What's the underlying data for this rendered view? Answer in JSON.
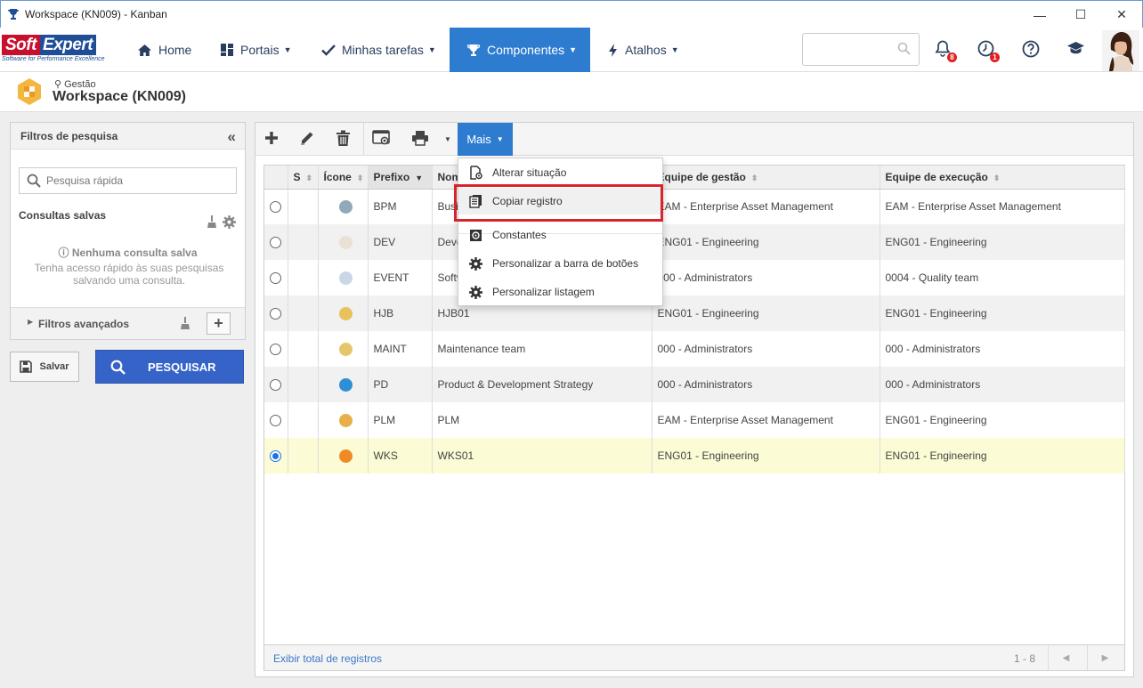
{
  "window": {
    "title": "Workspace (KN009) - Kanban",
    "controls": [
      "—",
      "☐",
      "✕"
    ]
  },
  "navbar": {
    "logo_soft": "Soft",
    "logo_expert": "Expert",
    "logo_tagline": "Software for Performance Excellence",
    "items": [
      {
        "label": "Home"
      },
      {
        "label": "Portais"
      },
      {
        "label": "Minhas tarefas"
      },
      {
        "label": "Componentes"
      },
      {
        "label": "Atalhos"
      }
    ],
    "notifications_badge": "8",
    "tasks_badge": "1",
    "accent": "#2e7cd0"
  },
  "header": {
    "breadcrumb": "Gestão",
    "title": "Workspace (KN009)"
  },
  "filters": {
    "title": "Filtros de pesquisa",
    "collapse": "«",
    "quick_search_placeholder": "Pesquisa rápida",
    "saved_title": "Consultas salvas",
    "no_saved": "Nenhuma consulta salva",
    "no_saved_desc": "Tenha acesso rápido às suas pesquisas salvando uma consulta.",
    "advanced": "Filtros avançados",
    "save_label": "Salvar",
    "search_label": "PESQUISAR"
  },
  "toolbar": {
    "more_label": "Mais"
  },
  "menu": {
    "items": [
      {
        "label": "Alterar situação",
        "icon": "change-status-icon"
      },
      {
        "label": "Copiar registro",
        "icon": "copy-icon"
      },
      {
        "label": "Constantes",
        "icon": "constants-icon"
      },
      {
        "label": "Personalizar a barra de botões",
        "icon": "gear-icon"
      },
      {
        "label": "Personalizar listagem",
        "icon": "gear-icon"
      }
    ]
  },
  "grid": {
    "columns": [
      "",
      "S",
      "Ícone",
      "Prefixo",
      "Nome",
      "Equipe de gestão",
      "Equipe de execução"
    ],
    "rows": [
      {
        "prefix": "BPM",
        "name": "Business Process Management",
        "mgmt": "EAM - Enterprise Asset Management",
        "exec": "EAM - Enterprise Asset Management",
        "icon_color": "#8fa9b8",
        "selected": false
      },
      {
        "prefix": "DEV",
        "name": "Development",
        "mgmt": "ENG01 - Engineering",
        "exec": "ENG01 - Engineering",
        "icon_color": "#e9e1d3",
        "selected": false
      },
      {
        "prefix": "EVENT",
        "name": "Software Event",
        "mgmt": "000 - Administrators",
        "exec": "0004 - Quality team",
        "icon_color": "#c9d7e8",
        "selected": false
      },
      {
        "prefix": "HJB",
        "name": "HJB01",
        "mgmt": "ENG01 - Engineering",
        "exec": "ENG01 - Engineering",
        "icon_color": "#e8c25a",
        "selected": false
      },
      {
        "prefix": "MAINT",
        "name": "Maintenance team",
        "mgmt": "000 - Administrators",
        "exec": "000 - Administrators",
        "icon_color": "#e6c66b",
        "selected": false
      },
      {
        "prefix": "PD",
        "name": "Product & Development Strategy",
        "mgmt": "000 - Administrators",
        "exec": "000 - Administrators",
        "icon_color": "#2f8fd6",
        "selected": false
      },
      {
        "prefix": "PLM",
        "name": "PLM",
        "mgmt": "EAM - Enterprise Asset Management",
        "exec": "ENG01 - Engineering",
        "icon_color": "#e8b04a",
        "selected": false
      },
      {
        "prefix": "WKS",
        "name": "WKS01",
        "mgmt": "ENG01 - Engineering",
        "exec": "ENG01 - Engineering",
        "icon_color": "#f08a24",
        "selected": true
      }
    ],
    "footer_total": "Exibir total de registros",
    "footer_range": "1 - 8"
  }
}
